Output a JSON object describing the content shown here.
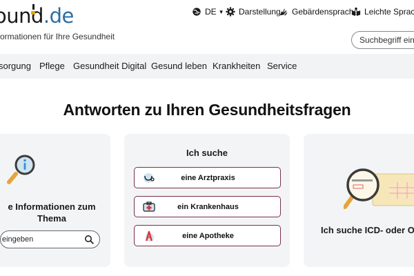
{
  "header": {
    "logo_main": "ound",
    "logo_suffix": ".de",
    "tagline": "ormationen für Ihre Gesundheit",
    "utility": {
      "language": "DE",
      "darstellung": "Darstellung",
      "gebaerdensprache": "Gebärdensprache",
      "leichte_sprache": "Leichte Sprache"
    },
    "search_placeholder": "Suchbegriff einge"
  },
  "nav": {
    "items": [
      {
        "label": "sorgung"
      },
      {
        "label": "Pflege"
      },
      {
        "label": "Gesundheit Digital"
      },
      {
        "label": "Gesund leben"
      },
      {
        "label": "Krankheiten"
      },
      {
        "label": "Service"
      }
    ]
  },
  "main": {
    "headline": "Antworten zu Ihren Gesundheitsfragen",
    "cards": {
      "left": {
        "title_line1": "e Informationen zum",
        "title_line2": "Thema",
        "input_text": "eingeben"
      },
      "middle": {
        "title": "Ich suche",
        "buttons": [
          {
            "label": "eine Arztpraxis",
            "icon": "stethoscope-icon"
          },
          {
            "label": "ein Krankenhaus",
            "icon": "hospital-kit-icon"
          },
          {
            "label": "eine Apotheke",
            "icon": "pharmacy-icon"
          }
        ]
      },
      "right": {
        "title": "Ich suche ICD- oder O"
      }
    }
  },
  "colors": {
    "accent_border": "#7a2f48",
    "logo_blue": "#2a6ea5",
    "logo_yellow": "#e4a700",
    "nav_bg": "#f2f3f5",
    "card_bg": "#f3f4f6"
  }
}
